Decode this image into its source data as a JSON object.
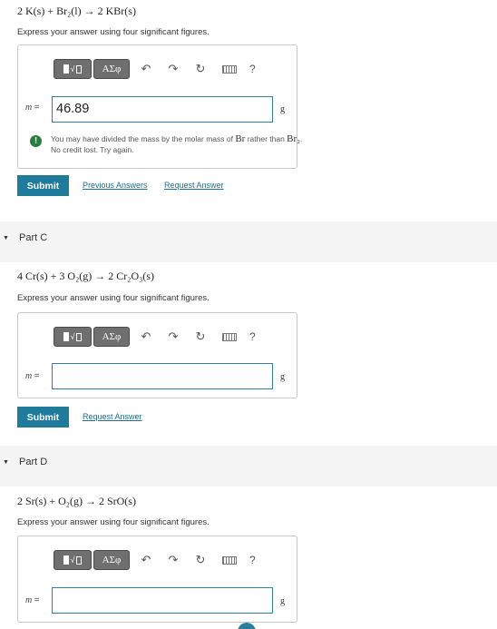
{
  "partB": {
    "equation": "2 K(s) + Br₂(l) → 2 KBr(s)",
    "instruction": "Express your answer using four significant figures.",
    "var_label": "m",
    "equals": "=",
    "input_value": "46.89",
    "unit": "g",
    "feedback_line1_a": "You may have divided the mass by the molar mass of ",
    "feedback_br": "Br",
    "feedback_line1_b": " rather than ",
    "feedback_br2": "Br₂",
    "feedback_line1_c": ".",
    "feedback_line2": "No credit lost. Try again.",
    "submit_label": "Submit",
    "previous_answers_label": "Previous Answers",
    "request_answer_label": "Request Answer"
  },
  "partC": {
    "title": "Part C",
    "equation": "4 Cr(s) + 3 O₂(g) → 2 Cr₂O₃(s)",
    "instruction": "Express your answer using four significant figures.",
    "var_label": "m",
    "equals": "=",
    "input_value": "",
    "unit": "g",
    "submit_label": "Submit",
    "request_answer_label": "Request Answer"
  },
  "partD": {
    "title": "Part D",
    "equation": "2 Sr(s) + O₂(g) → 2 SrO(s)",
    "instruction": "Express your answer using four significant figures.",
    "var_label": "m",
    "equals": "=",
    "input_value": "",
    "unit": "g"
  },
  "toolbar": {
    "template_label": "√",
    "symbols_label": "ΑΣφ",
    "undo_icon": "↶",
    "redo_icon": "↷",
    "reset_icon": "↻",
    "help_label": "?"
  },
  "colors": {
    "accent": "#1e7b9c",
    "link": "#1e6e93",
    "input_border": "#2f7fa8",
    "feedback_icon": "#2a7d3f"
  }
}
